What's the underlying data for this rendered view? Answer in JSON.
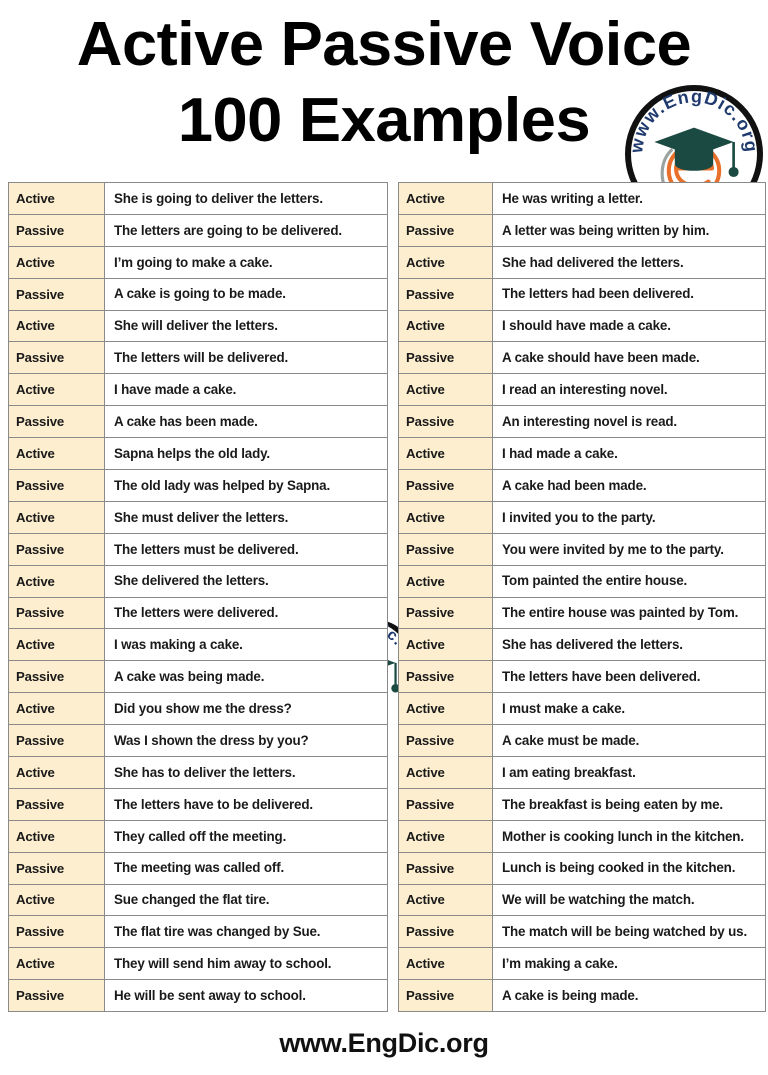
{
  "header": {
    "title_line_1": "Active Passive Voice",
    "title_line_2": "100 Examples"
  },
  "logo": {
    "ring_text": "www.EngDic.org",
    "cap_color": "#1b4a42",
    "monogram_color": "#e8702a",
    "ring_text_color": "#1f3a6e",
    "ring_color": "#111111",
    "alt": "engdic-logo"
  },
  "footer": {
    "site": "www.EngDic.org"
  },
  "labels": {
    "active": "Active",
    "passive": "Passive"
  },
  "colors": {
    "voice_cell_bg": "#fceece",
    "sentence_cell_bg": "#ffffff",
    "border": "#8a8a8a",
    "text": "#1a1a1a"
  },
  "left_table": [
    {
      "voice": "Active",
      "sentence": "She is going to deliver the letters."
    },
    {
      "voice": "Passive",
      "sentence": "The letters are going to be delivered."
    },
    {
      "voice": "Active",
      "sentence": "I’m going to make a cake."
    },
    {
      "voice": "Passive",
      "sentence": "A cake is going to be made."
    },
    {
      "voice": "Active",
      "sentence": "She will deliver the letters."
    },
    {
      "voice": "Passive",
      "sentence": "The letters will be delivered."
    },
    {
      "voice": "Active",
      "sentence": "I have made a cake."
    },
    {
      "voice": "Passive",
      "sentence": "A cake has been made."
    },
    {
      "voice": "Active",
      "sentence": "Sapna helps the old lady."
    },
    {
      "voice": "Passive",
      "sentence": "The old lady was helped by Sapna."
    },
    {
      "voice": "Active",
      "sentence": "She must deliver the letters."
    },
    {
      "voice": "Passive",
      "sentence": "The letters must be delivered."
    },
    {
      "voice": "Active",
      "sentence": "She delivered the letters."
    },
    {
      "voice": "Passive",
      "sentence": "The letters were delivered."
    },
    {
      "voice": "Active",
      "sentence": "I was making a cake."
    },
    {
      "voice": "Passive",
      "sentence": "A cake was being made."
    },
    {
      "voice": "Active",
      "sentence": "Did you show me the dress?"
    },
    {
      "voice": "Passive",
      "sentence": "Was I shown the dress by you?"
    },
    {
      "voice": "Active",
      "sentence": "She has to deliver the letters."
    },
    {
      "voice": "Passive",
      "sentence": "The letters have to be delivered."
    },
    {
      "voice": "Active",
      "sentence": "They called off the meeting."
    },
    {
      "voice": "Passive",
      "sentence": "The meeting was called off."
    },
    {
      "voice": "Active",
      "sentence": "Sue changed the flat tire."
    },
    {
      "voice": "Passive",
      "sentence": "The flat tire was changed by Sue."
    },
    {
      "voice": "Active",
      "sentence": "They will send him away to school."
    },
    {
      "voice": "Passive",
      "sentence": "He will be sent away to school."
    }
  ],
  "right_table": [
    {
      "voice": "Active",
      "sentence": "He was writing a letter."
    },
    {
      "voice": "Passive",
      "sentence": " A letter was being written by him."
    },
    {
      "voice": "Active",
      "sentence": "She had delivered the letters."
    },
    {
      "voice": "Passive",
      "sentence": "The letters had been delivered."
    },
    {
      "voice": "Active",
      "sentence": "I should have made a cake."
    },
    {
      "voice": "Passive",
      "sentence": "A cake should have been made."
    },
    {
      "voice": "Active",
      "sentence": "I read an interesting novel."
    },
    {
      "voice": "Passive",
      "sentence": "An interesting novel is read."
    },
    {
      "voice": "Active",
      "sentence": "I had made a cake."
    },
    {
      "voice": "Passive",
      "sentence": "A cake had been made."
    },
    {
      "voice": "Active",
      "sentence": "I invited you to the party."
    },
    {
      "voice": "Passive",
      "sentence": "You were invited by me to the party."
    },
    {
      "voice": "Active",
      "sentence": "Tom painted the entire house."
    },
    {
      "voice": "Passive",
      "sentence": "The entire house was painted by Tom."
    },
    {
      "voice": "Active",
      "sentence": "She has delivered the letters."
    },
    {
      "voice": "Passive",
      "sentence": "The letters have been delivered."
    },
    {
      "voice": "Active",
      "sentence": "I must make a cake."
    },
    {
      "voice": "Passive",
      "sentence": "A cake must be made."
    },
    {
      "voice": "Active",
      "sentence": "I am eating breakfast."
    },
    {
      "voice": "Passive",
      "sentence": "The breakfast is being eaten by me."
    },
    {
      "voice": "Active",
      "sentence": "Mother is cooking lunch in the kitchen."
    },
    {
      "voice": "Passive",
      "sentence": "Lunch is being cooked in the kitchen."
    },
    {
      "voice": "Active",
      "sentence": "We will be watching the match."
    },
    {
      "voice": "Passive",
      "sentence": "The match will be being watched by us."
    },
    {
      "voice": "Active",
      "sentence": "I’m making a cake."
    },
    {
      "voice": "Passive",
      "sentence": "A cake is being made."
    }
  ]
}
